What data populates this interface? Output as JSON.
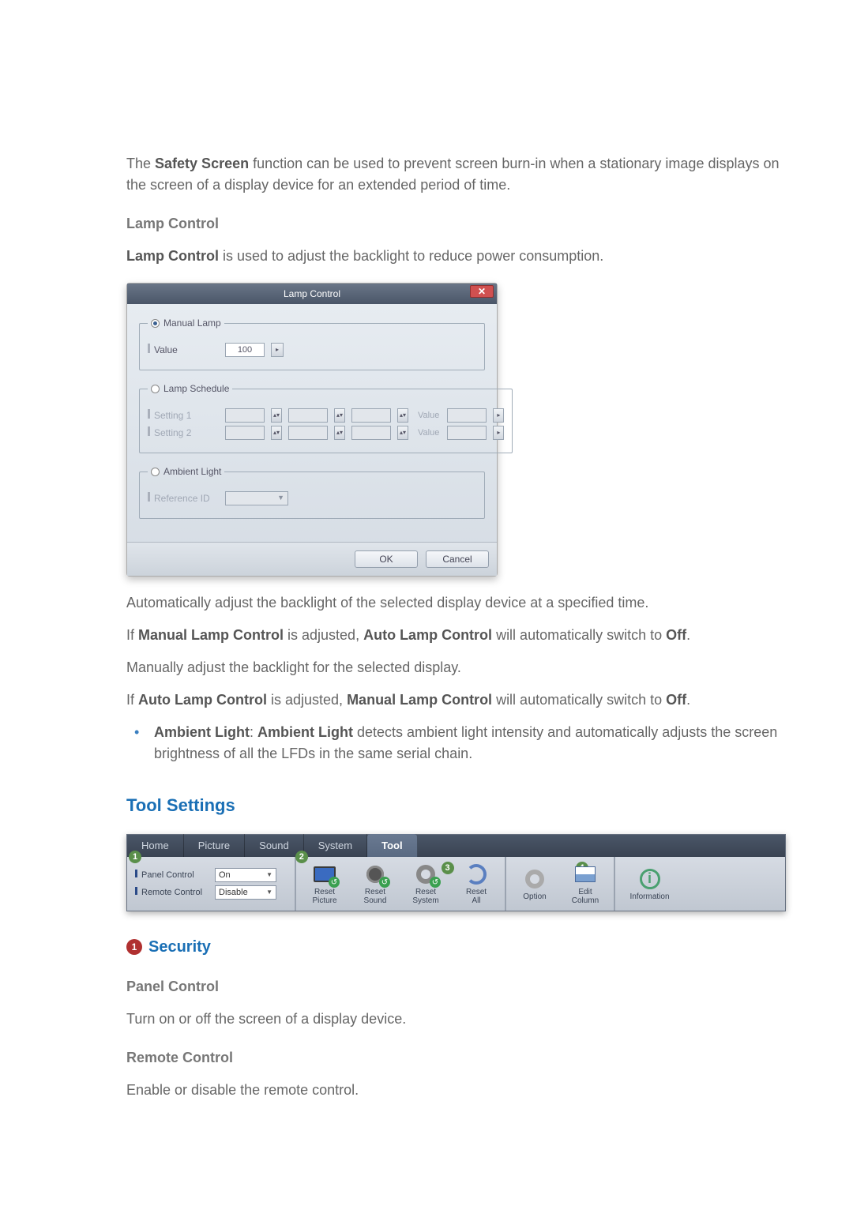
{
  "intro": {
    "safety_para_1a": "The ",
    "safety_bold": "Safety Screen",
    "safety_para_1b": " function can be used to prevent screen burn-in when a stationary image displays on the screen of a display device for an extended period of time."
  },
  "lamp": {
    "heading": "Lamp Control",
    "desc_prefix_bold": "Lamp Control",
    "desc_rest": " is used to adjust the backlight to reduce power consumption.",
    "dialog": {
      "title": "Lamp Control",
      "close": "✕",
      "manual_lamp": {
        "legend": "Manual Lamp",
        "value_label": "Value",
        "value": "100"
      },
      "lamp_schedule": {
        "legend": "Lamp Schedule",
        "setting1": "Setting 1",
        "setting2": "Setting 2",
        "value_label": "Value"
      },
      "ambient_light": {
        "legend": "Ambient Light",
        "reference_label": "Reference ID"
      },
      "ok": "OK",
      "cancel": "Cancel"
    },
    "auto_adjust": "Automatically adjust the backlight of the selected display device at a specified time.",
    "manual_if_a": "If ",
    "manual_if_bold1": "Manual Lamp Control",
    "manual_if_b": " is adjusted, ",
    "manual_if_bold2": "Auto Lamp Control",
    "manual_if_c": " will automatically switch to ",
    "manual_if_bold3": "Off",
    "manual_if_d": ".",
    "manual_adjust": "Manually adjust the backlight for the selected display.",
    "auto_if_a": "If ",
    "auto_if_bold1": "Auto Lamp Control",
    "auto_if_b": " is adjusted, ",
    "auto_if_bold2": "Manual Lamp Control",
    "auto_if_c": " will automatically switch to ",
    "auto_if_bold3": "Off",
    "auto_if_d": ".",
    "ambient_bold1": "Ambient Light",
    "ambient_sep": ": ",
    "ambient_bold2": "Ambient Light",
    "ambient_rest": " detects ambient light intensity and automatically adjusts the screen brightness of all the LFDs in the same serial chain."
  },
  "tool_settings": {
    "heading": "Tool Settings",
    "tabs": {
      "home": "Home",
      "picture": "Picture",
      "sound": "Sound",
      "system": "System",
      "tool": "Tool"
    },
    "markers": {
      "m1": "1",
      "m2": "2",
      "m3": "3",
      "m4": "4"
    },
    "security": {
      "panel_control": "Panel Control",
      "panel_value": "On",
      "remote_control": "Remote Control",
      "remote_value": "Disable"
    },
    "buttons": {
      "reset_picture_l1": "Reset",
      "reset_picture_l2": "Picture",
      "reset_sound_l1": "Reset",
      "reset_sound_l2": "Sound",
      "reset_system_l1": "Reset",
      "reset_system_l2": "System",
      "reset_all_l1": "Reset",
      "reset_all_l2": "All",
      "option": "Option",
      "edit_col_l1": "Edit",
      "edit_col_l2": "Column",
      "information": "Information"
    }
  },
  "security": {
    "num": "1",
    "heading": "Security",
    "panel_heading": "Panel Control",
    "panel_desc": "Turn on or off the screen of a display device.",
    "remote_heading": "Remote Control",
    "remote_desc": "Enable or disable the remote control."
  }
}
